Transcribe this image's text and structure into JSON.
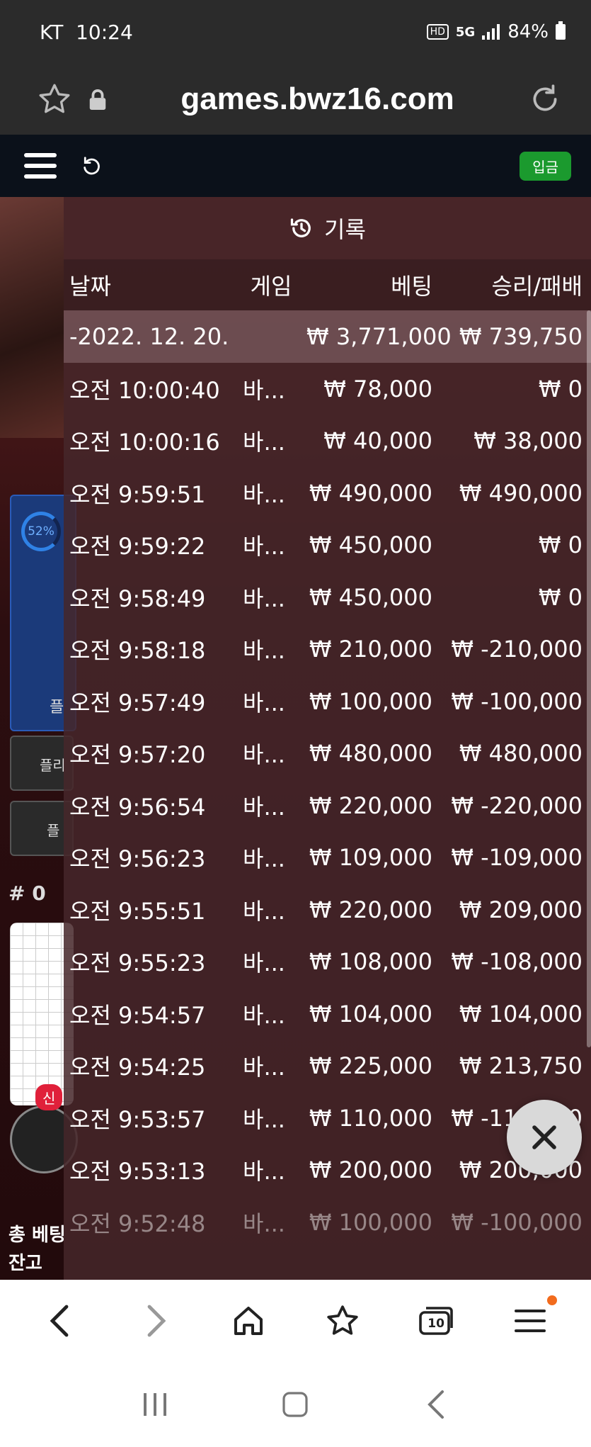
{
  "status": {
    "carrier": "KT",
    "time": "10:24",
    "net": "5G",
    "battery": "84%"
  },
  "browser": {
    "url": "games.bwz16.com"
  },
  "game": {
    "deposit_label": "입금",
    "side_percent": "52%",
    "side_label_1": "플",
    "side_btn_1": "플리",
    "side_btn_2": "플",
    "round_label": "# 0",
    "new_badge": "신",
    "total_bet_label": "총 베팅",
    "balance_label": "잔고"
  },
  "history": {
    "title": "기록",
    "headers": [
      "날짜",
      "게임",
      "베팅",
      "승리/패배"
    ],
    "summary": {
      "date": "-2022. 12. 20.",
      "bet": "₩ 3,771,000",
      "result": "₩ 739,750"
    },
    "rows": [
      {
        "time": "오전 10:00:40",
        "game": "바...",
        "bet": "₩ 78,000",
        "result": "₩ 0"
      },
      {
        "time": "오전 10:00:16",
        "game": "바...",
        "bet": "₩ 40,000",
        "result": "₩ 38,000"
      },
      {
        "time": "오전 9:59:51",
        "game": "바...",
        "bet": "₩ 490,000",
        "result": "₩ 490,000"
      },
      {
        "time": "오전 9:59:22",
        "game": "바...",
        "bet": "₩ 450,000",
        "result": "₩ 0"
      },
      {
        "time": "오전 9:58:49",
        "game": "바...",
        "bet": "₩ 450,000",
        "result": "₩ 0"
      },
      {
        "time": "오전 9:58:18",
        "game": "바...",
        "bet": "₩ 210,000",
        "result": "₩ -210,000"
      },
      {
        "time": "오전 9:57:49",
        "game": "바...",
        "bet": "₩ 100,000",
        "result": "₩ -100,000"
      },
      {
        "time": "오전 9:57:20",
        "game": "바...",
        "bet": "₩ 480,000",
        "result": "₩ 480,000"
      },
      {
        "time": "오전 9:56:54",
        "game": "바...",
        "bet": "₩ 220,000",
        "result": "₩ -220,000"
      },
      {
        "time": "오전 9:56:23",
        "game": "바...",
        "bet": "₩ 109,000",
        "result": "₩ -109,000"
      },
      {
        "time": "오전 9:55:51",
        "game": "바...",
        "bet": "₩ 220,000",
        "result": "₩ 209,000"
      },
      {
        "time": "오전 9:55:23",
        "game": "바...",
        "bet": "₩ 108,000",
        "result": "₩ -108,000"
      },
      {
        "time": "오전 9:54:57",
        "game": "바...",
        "bet": "₩ 104,000",
        "result": "₩ 104,000"
      },
      {
        "time": "오전 9:54:25",
        "game": "바...",
        "bet": "₩ 225,000",
        "result": "₩ 213,750"
      },
      {
        "time": "오전 9:53:57",
        "game": "바...",
        "bet": "₩ 110,000",
        "result": "₩ -110,000"
      },
      {
        "time": "오전 9:53:13",
        "game": "바...",
        "bet": "₩ 200,000",
        "result": "₩ 200,000"
      },
      {
        "time": "오전 9:52:48",
        "game": "바...",
        "bet": "₩ 100,000",
        "result": "₩ -100,000"
      }
    ]
  },
  "toolbar": {
    "tabs_count": "10"
  },
  "colors": {
    "deposit": "#1b9a2e",
    "notify_dot": "#f26b1d",
    "new_badge": "#e0203a"
  }
}
